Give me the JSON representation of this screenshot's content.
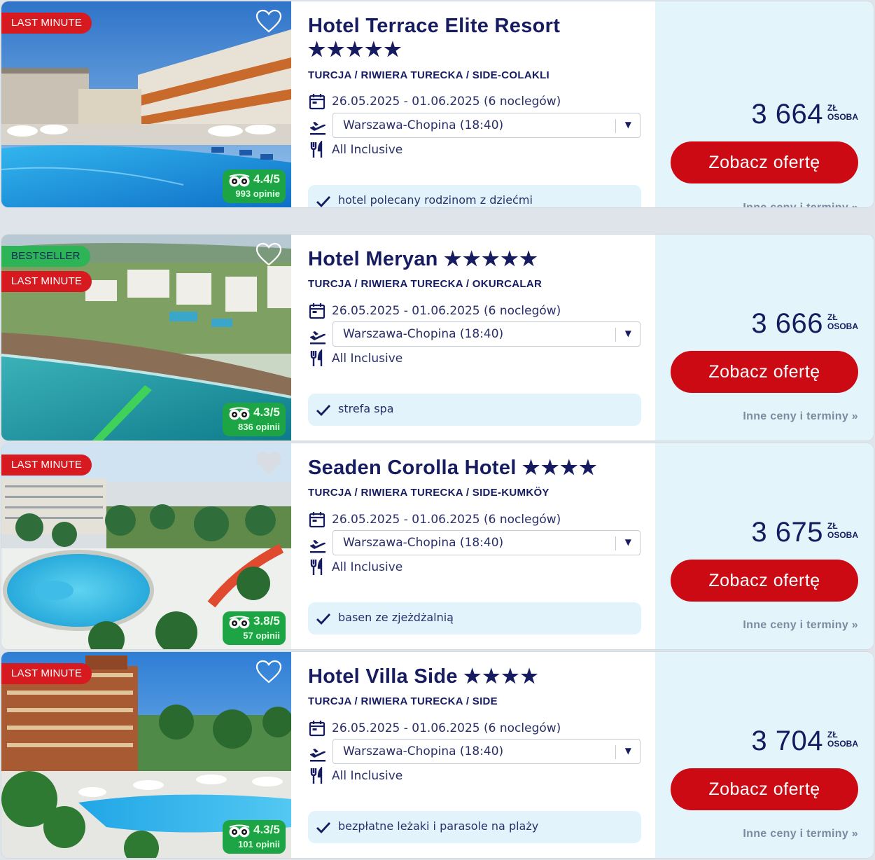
{
  "colors": {
    "brand_navy": "#171c61",
    "cta_red": "#cc0a14",
    "badge_red": "#d71920",
    "badge_green": "#2db457",
    "tripadvisor_green": "#1da445",
    "price_panel_bg": "#e4f4fb",
    "feature_bg": "#e3f3fc"
  },
  "labels": {
    "cta": "Zobacz ofertę",
    "more_prices": "Inne ceny i terminy »",
    "currency": "ZŁ",
    "per": "OSOBA"
  },
  "offers": [
    {
      "badges": [
        "LAST MINUTE"
      ],
      "favorite": false,
      "rating": {
        "score": "4.4/5",
        "count": "993 opinie"
      },
      "name": "Hotel Terrace Elite Resort",
      "stars": "★★★★★",
      "star_count": 5,
      "location": "TURCJA / RIWIERA TURECKA / SIDE-COLAKLI",
      "dates": "26.05.2025 - 01.06.2025 (6 noclegów)",
      "departure": "Warszawa-Chopina (18:40)",
      "board": "All Inclusive",
      "feature": "hotel polecany rodzinom z dziećmi",
      "price": "3 664"
    },
    {
      "badges": [
        "BESTSELLER",
        "LAST MINUTE"
      ],
      "favorite": false,
      "rating": {
        "score": "4.3/5",
        "count": "836 opinii"
      },
      "name": "Hotel Meryan",
      "stars": "★★★★★",
      "star_count": 5,
      "location": "TURCJA / RIWIERA TURECKA / OKURCALAR",
      "dates": "26.05.2025 - 01.06.2025 (6 noclegów)",
      "departure": "Warszawa-Chopina (18:40)",
      "board": "All Inclusive",
      "feature": "strefa spa",
      "price": "3 666"
    },
    {
      "badges": [
        "LAST MINUTE"
      ],
      "favorite": true,
      "rating": {
        "score": "3.8/5",
        "count": "57 opinii"
      },
      "name": "Seaden Corolla Hotel",
      "stars": "★★★★",
      "star_count": 4,
      "location": "TURCJA / RIWIERA TURECKA / SIDE-KUMKÖY",
      "dates": "26.05.2025 - 01.06.2025 (6 noclegów)",
      "departure": "Warszawa-Chopina (18:40)",
      "board": "All Inclusive",
      "feature": "basen ze zjeżdżalnią",
      "price": "3 675"
    },
    {
      "badges": [
        "LAST MINUTE"
      ],
      "favorite": false,
      "rating": {
        "score": "4.3/5",
        "count": "101 opinii"
      },
      "name": "Hotel Villa Side",
      "stars": "★★★★",
      "star_count": 4,
      "location": "TURCJA / RIWIERA TURECKA / SIDE",
      "dates": "26.05.2025 - 01.06.2025 (6 noclegów)",
      "departure": "Warszawa-Chopina (18:40)",
      "board": "All Inclusive",
      "feature": "bezpłatne leżaki i parasole na plaży",
      "price": "3 704"
    }
  ]
}
